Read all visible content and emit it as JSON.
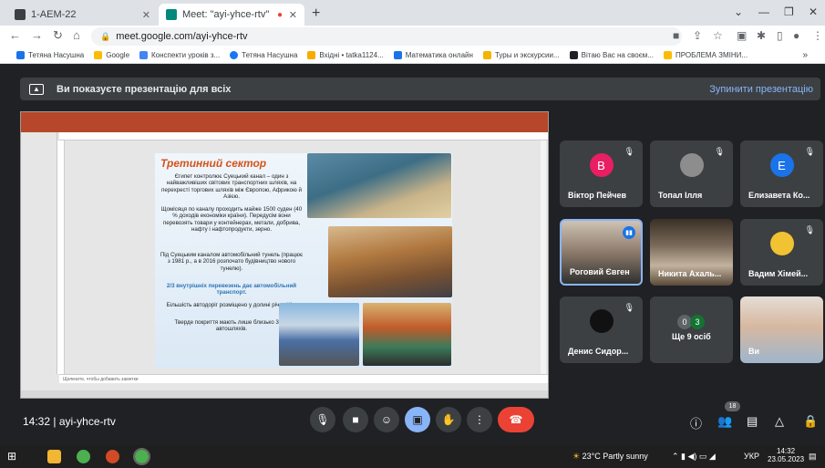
{
  "browser": {
    "tabs": [
      {
        "title": "1-АЕМ-22",
        "active": false,
        "color": "#3c4043"
      },
      {
        "title": "Meet: \"ayi-yhce-rtv\"",
        "active": true,
        "color": "#00897b"
      }
    ],
    "url": "meet.google.com/ayi-yhce-rtv",
    "bookmarks": [
      {
        "label": "Тетяна Насушна",
        "color": "#1a73e8"
      },
      {
        "label": "Google",
        "color": "#fbbc04"
      },
      {
        "label": "Конспекти уроків з...",
        "color": "#4285f4"
      },
      {
        "label": "Тетяна Насушна",
        "color": "#1877f2"
      },
      {
        "label": "Вхідні • tatka1124...",
        "color": "#f9ab00"
      },
      {
        "label": "Математика онлайн",
        "color": "#1a73e8"
      },
      {
        "label": "Туры и экскурсии...",
        "color": "#f4b400"
      },
      {
        "label": "Вітаю Вас на своєм...",
        "color": "#202124"
      },
      {
        "label": "ПРОБЛЕМА ЗМІНИ...",
        "color": "#fbbc04"
      }
    ]
  },
  "meet": {
    "banner_text": "Ви показуєте презентацію для всіх",
    "stop_label": "Зупинити презентацію",
    "meeting_time": "14:32",
    "meeting_code": "ayi-yhce-rtv",
    "people_count": "18",
    "participants": [
      {
        "name": "Віктор Пейчев",
        "initial": "B",
        "avatar_color": "#e91e63",
        "type": "avatar"
      },
      {
        "name": "Топал Ілля",
        "initial": "",
        "avatar_color": "#9e9e9e",
        "type": "photo"
      },
      {
        "name": "Елизавета Ко...",
        "initial": "E",
        "avatar_color": "#1a73e8",
        "type": "avatar"
      },
      {
        "name": "Роговий Євген",
        "initial": "",
        "avatar_color": "#6b5b4d",
        "type": "video"
      },
      {
        "name": "Никита Ахаль...",
        "initial": "",
        "avatar_color": "#5a4a3a",
        "type": "video"
      },
      {
        "name": "Вадим Хімей...",
        "initial": "",
        "avatar_color": "#f1c232",
        "type": "photo"
      },
      {
        "name": "Денис Сидор...",
        "initial": "",
        "avatar_color": "#111111",
        "type": "avatar"
      },
      {
        "name": "Ще 9 осіб",
        "initial": "",
        "avatar_color": "#5f6368",
        "type": "more"
      },
      {
        "name": "Ви",
        "initial": "",
        "avatar_color": "#b7a79a",
        "type": "video"
      }
    ]
  },
  "slide": {
    "title": "Третинний сектор",
    "p1": "Єгипет контролює Суецький канал – один з найважливіших світових транспортних шляхів, на перехресті торгових шляхів між Європою, Африкою й Азією.",
    "p2": "Щомісяця по каналу проходить майже 1500 суден (40 % доходів економіки країни). Передусім вони перевозять товари у контейнерах, метали, добрива, нафту і нафтопродукти, зерно.",
    "p3": "Під Суецьким каналом автомобільний тунель (працює з 1981 р., а в 2016 розпочато будівництво нового тунелю).",
    "p4": "2/3 внутрішніх перевезень дає автомобільний транспорт.",
    "p5": "Більшість автодоріг розміщено у долині річки Ніл.",
    "p6": "Тверде покриття мають лише близько 30 % автошляхів.",
    "notes_placeholder": "Щелкните, чтобы добавить заметки"
  },
  "taskbar": {
    "weather": "23°C  Partly sunny",
    "lang": "УКР",
    "time": "14:32",
    "date": "23.05.2023"
  }
}
